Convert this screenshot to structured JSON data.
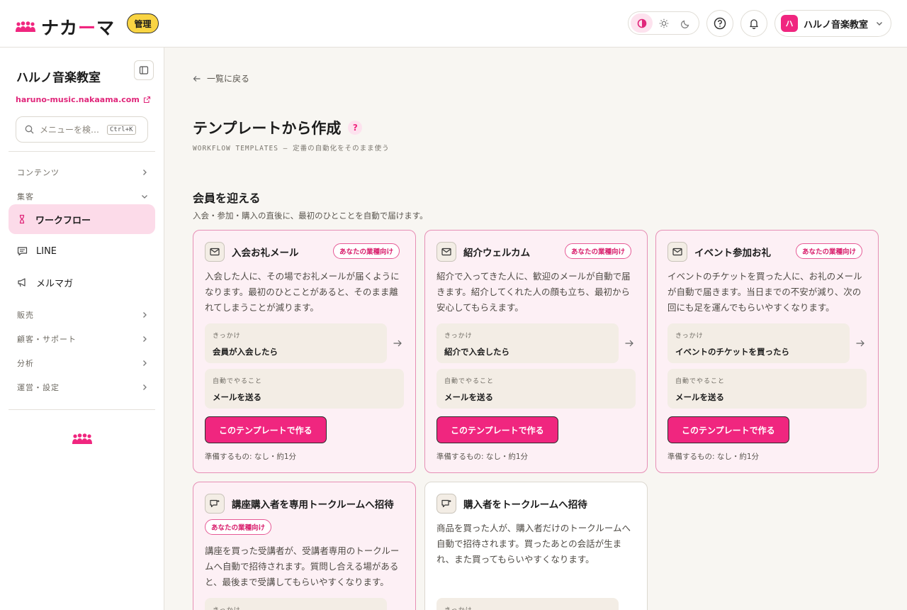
{
  "header": {
    "logo_text_1": "ナカ",
    "logo_text_accent": "ー",
    "logo_text_2": "マ",
    "admin_badge": "管理",
    "theme": {
      "options": [
        "contrast-icon",
        "sun-icon",
        "moon-icon"
      ],
      "active": "contrast"
    },
    "account_avatar": "ハ",
    "account_name": "ハルノ音楽教室"
  },
  "sidebar": {
    "title": "ハルノ音楽教室",
    "url": "haruno-music.nakaama.com",
    "search_placeholder": "メニューを検…",
    "search_kbd": "Ctrl+K",
    "sections": {
      "contents": "コンテンツ",
      "acquisition": "集客",
      "sales": "販売",
      "customers": "顧客・サポート",
      "analytics": "分析",
      "operations": "運営・設定"
    },
    "items": {
      "workflow": "ワークフロー",
      "line": "LINE",
      "mailmag": "メルマガ"
    }
  },
  "main": {
    "back_label": "一覧に戻る",
    "page_title": "テンプレートから作成",
    "help": "?",
    "subtitle": "WORKFLOW TEMPLATES — 定番の自動化をそのまま使う",
    "section_title": "会員を迎える",
    "section_desc": "入会・参加・購入の直後に、最初のひとことを自動で届けます。",
    "labels": {
      "trigger": "きっかけ",
      "action": "自動でやること",
      "cta": "このテンプレートで作る",
      "prep": "準備するもの: なし・約1分",
      "badge": "あなたの業種向け"
    },
    "cards": [
      {
        "title": "入会お礼メール",
        "desc": "入会した人に、その場でお礼メールが届くようになります。最初のひとことがあると、そのまま離れてしまうことが減ります。",
        "trigger": "会員が入会したら",
        "action": "メールを送る"
      },
      {
        "title": "紹介ウェルカム",
        "desc": "紹介で入ってきた人に、歓迎のメールが自動で届きます。紹介してくれた人の顔も立ち、最初から安心してもらえます。",
        "trigger": "紹介で入会したら",
        "action": "メールを送る"
      },
      {
        "title": "イベント参加お礼",
        "desc": "イベントのチケットを買った人に、お礼のメールが自動で届きます。当日までの不安が減り、次の回にも足を運んでもらいやすくなります。",
        "trigger": "イベントのチケットを買ったら",
        "action": "メールを送る"
      },
      {
        "title": "講座購入者を専用トークルームへ招待",
        "desc": "講座を買った受講者が、受講者専用のトークルームへ自動で招待されます。質問し合える場があると、最後まで受講してもらいやすくなります。"
      },
      {
        "title": "購入者をトークルームへ招待",
        "desc": "商品を買った人が、購入者だけのトークルームへ自動で招待されます。買ったあとの会話が生まれ、また買ってもらいやすくなります。"
      }
    ]
  },
  "colors": {
    "accent": "#f0267f",
    "badge_yellow": "#f9d443",
    "card_bg": "#fdf0f5",
    "card_border": "#e68fb5",
    "step_bg": "#f3ede5"
  }
}
